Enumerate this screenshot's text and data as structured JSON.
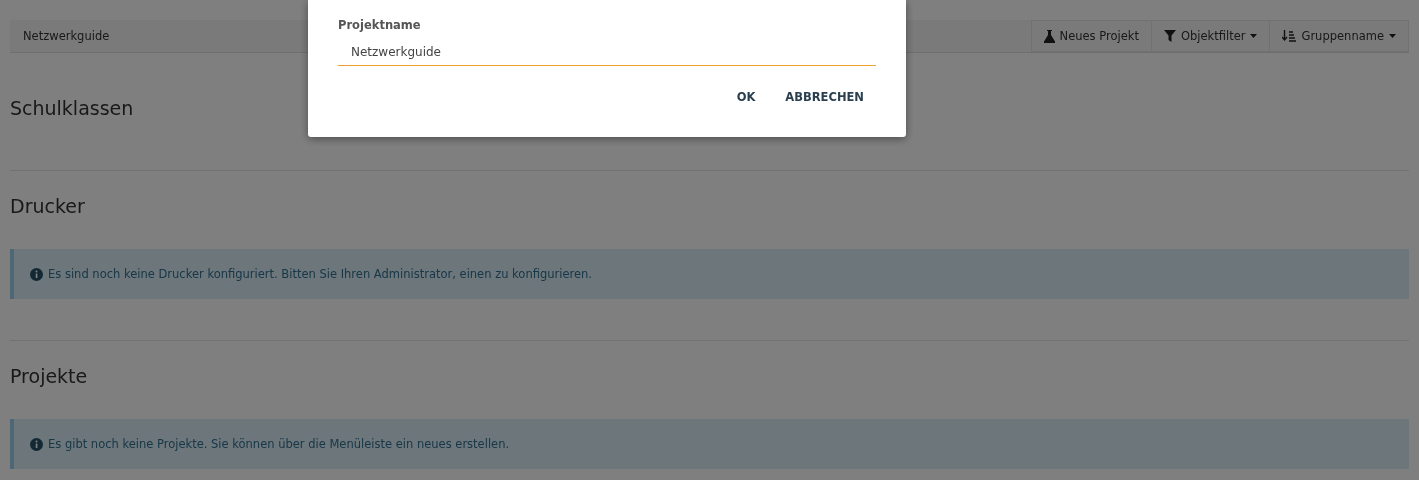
{
  "breadcrumb": {
    "label": "Netzwerkguide"
  },
  "toolbar": [
    {
      "kind": "flask",
      "label": "Neues Projekt",
      "dropdown": false
    },
    {
      "kind": "filter",
      "label": "Objektfilter",
      "dropdown": true
    },
    {
      "kind": "sort",
      "label": "Gruppenname",
      "dropdown": true
    }
  ],
  "sections": [
    {
      "title": "Schulklassen"
    },
    {
      "title": "Drucker",
      "alert": "Es sind noch keine Drucker konfiguriert. Bitten Sie Ihren Administrator, einen zu konfigurieren."
    },
    {
      "title": "Projekte",
      "alert": "Es gibt noch keine Projekte. Sie können über die Menüleiste ein neues erstellen."
    }
  ],
  "dialog": {
    "field_label": "Projektname",
    "value": "Netzwerkguide",
    "buttons": [
      "OK",
      "ABBRECHEN"
    ]
  }
}
